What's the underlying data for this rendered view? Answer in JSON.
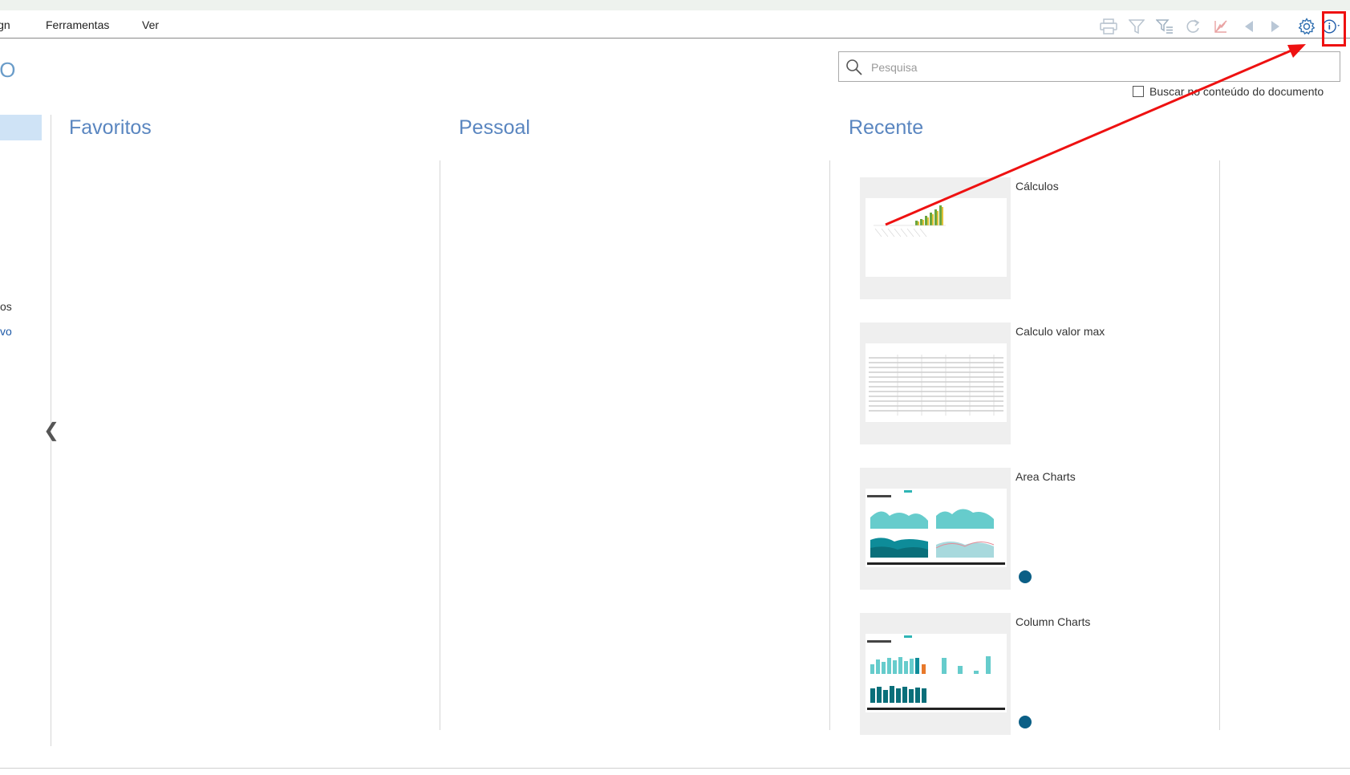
{
  "menu": {
    "design": "ign",
    "tools": "Ferramentas",
    "view": "Ver"
  },
  "toolbar": {
    "icons": [
      "print-icon",
      "filter-icon",
      "filter-clear-icon",
      "refresh-icon",
      "dismiss-icon",
      "back-icon",
      "forward-icon",
      "gear-icon",
      "info-icon"
    ]
  },
  "page": {
    "title_fragment": "/O"
  },
  "search": {
    "placeholder": "Pesquisa",
    "value": ""
  },
  "search_content": {
    "label": "Buscar no conteúdo do documento",
    "checked": false
  },
  "sidebar": {
    "items": [
      {
        "label": "os"
      },
      {
        "label": "vo"
      }
    ]
  },
  "columns": {
    "favorites": "Favoritos",
    "personal": "Pessoal",
    "recent": "Recente"
  },
  "recent_items": [
    {
      "title": "Cálculos"
    },
    {
      "title": "Calculo valor max"
    },
    {
      "title": "Area Charts"
    },
    {
      "title": "Column Charts"
    }
  ],
  "colors": {
    "accent": "#5a86c0",
    "annotation": "#e11111",
    "dot": "#0b5f86",
    "selected": "#cfe3f6"
  }
}
